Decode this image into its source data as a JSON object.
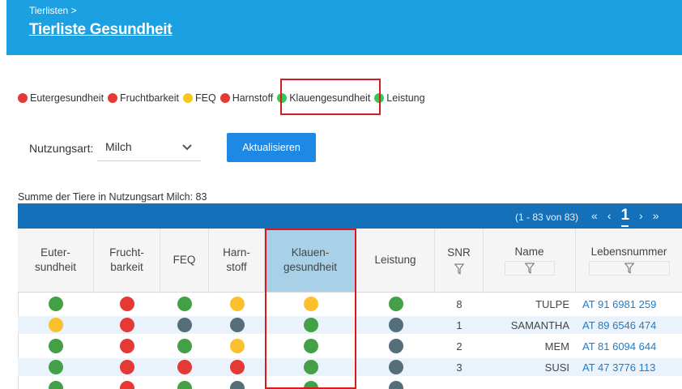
{
  "header": {
    "breadcrumb": "Tierlisten >",
    "title": "Tierliste Gesundheit"
  },
  "legend": [
    {
      "label": "Eutergesundheit",
      "color": "#e53935"
    },
    {
      "label": "Fruchtbarkeit",
      "color": "#e53935"
    },
    {
      "label": "FEQ",
      "color": "#f9c61a"
    },
    {
      "label": "Harnstoff",
      "color": "#e53935"
    },
    {
      "label": "Klauengesundheit",
      "color": "#34c759"
    },
    {
      "label": "Leistung",
      "color": "#34c759"
    }
  ],
  "filter": {
    "label": "Nutzungsart:",
    "selected": "Milch",
    "button": "Aktualisieren"
  },
  "summary": "Summe der Tiere in Nutzungsart Milch: 83",
  "pager": {
    "range": "(1 - 83 von 83)",
    "first": "«",
    "prev": "‹",
    "current": "1",
    "next": "›",
    "last": "»"
  },
  "columns": {
    "euter": [
      "Euter-",
      "sundheit"
    ],
    "frucht": [
      "Frucht-",
      "barkeit"
    ],
    "feq": "FEQ",
    "harn": [
      "Harn-",
      "stoff"
    ],
    "klauen": [
      "Klauen-",
      "gesundheit"
    ],
    "leistung": "Leistung",
    "snr": "SNR",
    "name": "Name",
    "lnr": "Lebensnummer"
  },
  "colors": {
    "green": "#43a047",
    "red": "#e53935",
    "yellow": "#fbc02d",
    "gray": "#546e7a"
  },
  "rows": [
    {
      "euter": "green",
      "frucht": "red",
      "feq": "green",
      "harn": "yellow",
      "klauen": "yellow",
      "leistung": "green",
      "snr": "8",
      "name": "TULPE",
      "lnr": "AT 91 6981 259"
    },
    {
      "euter": "yellow",
      "frucht": "red",
      "feq": "gray",
      "harn": "gray",
      "klauen": "green",
      "leistung": "gray",
      "snr": "1",
      "name": "SAMANTHA",
      "lnr": "AT 89 6546 474"
    },
    {
      "euter": "green",
      "frucht": "red",
      "feq": "green",
      "harn": "yellow",
      "klauen": "green",
      "leistung": "gray",
      "snr": "2",
      "name": "MEM",
      "lnr": "AT 81 6094 644"
    },
    {
      "euter": "green",
      "frucht": "red",
      "feq": "red",
      "harn": "red",
      "klauen": "green",
      "leistung": "gray",
      "snr": "3",
      "name": "SUSI",
      "lnr": "AT 47 3776 113"
    },
    {
      "euter": "green",
      "frucht": "red",
      "feq": "green",
      "harn": "gray",
      "klauen": "green",
      "leistung": "gray",
      "snr": "",
      "name": "",
      "lnr": ""
    }
  ]
}
